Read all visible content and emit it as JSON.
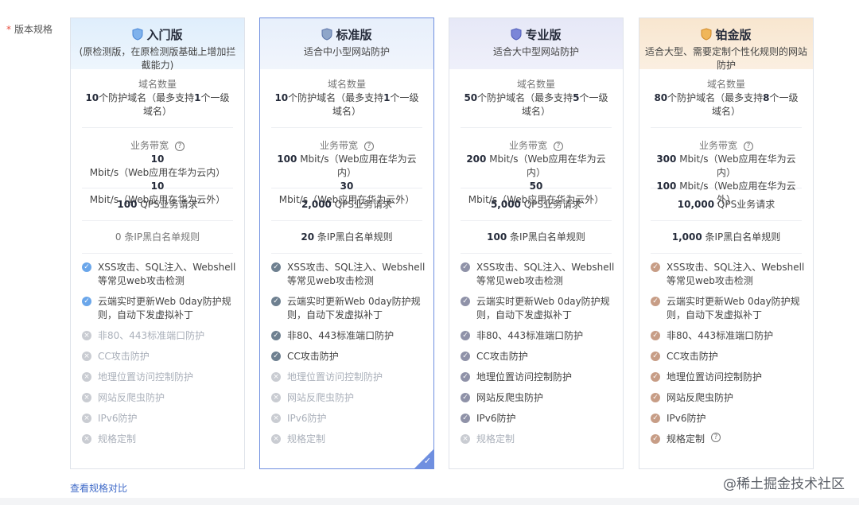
{
  "field_label": "版本规格",
  "icons": {
    "check": "✓",
    "cross": "×",
    "help": "?",
    "shield": "shield-icon"
  },
  "colors": {
    "selected_border": "#6f8fe0",
    "entry_check": "#6aa6ea",
    "std_check": "#6e8090",
    "pro_check": "#8f92a8",
    "plat_check": "#c79d86",
    "disabled": "#c9ccd2"
  },
  "plans": [
    {
      "name": "入门版",
      "subtitle": "(原检测版，在原检测版基础上增加拦截能力)",
      "domain_label": "域名数量",
      "domain_count": "10",
      "domain_mid": "个防护域名（最多支持",
      "domain_top": "1",
      "domain_tail": "个一级域名）",
      "bw_label": "业务带宽",
      "bw_in_val": "10",
      "bw_in_text": " Mbit/s（Web应用在华为云内）",
      "bw_out_val": "10",
      "bw_out_text": " Mbit/s（Web应用在华为云外）",
      "qps_val": "100",
      "qps_text": " QPS业务请求",
      "ip_val": "0",
      "ip_text": " 条IP黑白名单规则",
      "features": [
        {
          "text": "XSS攻击、SQL注入、Webshell等常见web攻击检测",
          "on": true
        },
        {
          "text": "云端实时更新Web 0day防护规则，自动下发虚拟补丁",
          "on": true
        },
        {
          "text": "非80、443标准端口防护",
          "on": false
        },
        {
          "text": "CC攻击防护",
          "on": false
        },
        {
          "text": "地理位置访问控制防护",
          "on": false
        },
        {
          "text": "网站反爬虫防护",
          "on": false
        },
        {
          "text": "IPv6防护",
          "on": false
        },
        {
          "text": "规格定制",
          "on": false
        }
      ]
    },
    {
      "name": "标准版",
      "subtitle": "适合中小型网站防护",
      "domain_label": "域名数量",
      "domain_count": "10",
      "domain_mid": "个防护域名（最多支持",
      "domain_top": "1",
      "domain_tail": "个一级域名）",
      "bw_label": "业务带宽",
      "bw_in_val": "100",
      "bw_in_text": " Mbit/s（Web应用在华为云内）",
      "bw_out_val": "30",
      "bw_out_text": " Mbit/s（Web应用在华为云外）",
      "qps_val": "2,000",
      "qps_text": " QPS业务请求",
      "ip_val": "20",
      "ip_text": " 条IP黑白名单规则",
      "features": [
        {
          "text": "XSS攻击、SQL注入、Webshell等常见web攻击检测",
          "on": true
        },
        {
          "text": "云端实时更新Web 0day防护规则，自动下发虚拟补丁",
          "on": true
        },
        {
          "text": "非80、443标准端口防护",
          "on": true
        },
        {
          "text": "CC攻击防护",
          "on": true
        },
        {
          "text": "地理位置访问控制防护",
          "on": false
        },
        {
          "text": "网站反爬虫防护",
          "on": false
        },
        {
          "text": "IPv6防护",
          "on": false
        },
        {
          "text": "规格定制",
          "on": false
        }
      ]
    },
    {
      "name": "专业版",
      "subtitle": "适合大中型网站防护",
      "domain_label": "域名数量",
      "domain_count": "50",
      "domain_mid": "个防护域名（最多支持",
      "domain_top": "5",
      "domain_tail": "个一级域名）",
      "bw_label": "业务带宽",
      "bw_in_val": "200",
      "bw_in_text": " Mbit/s（Web应用在华为云内）",
      "bw_out_val": "50",
      "bw_out_text": " Mbit/s（Web应用在华为云外）",
      "qps_val": "5,000",
      "qps_text": " QPS业务请求",
      "ip_val": "100",
      "ip_text": " 条IP黑白名单规则",
      "features": [
        {
          "text": "XSS攻击、SQL注入、Webshell等常见web攻击检测",
          "on": true
        },
        {
          "text": "云端实时更新Web 0day防护规则，自动下发虚拟补丁",
          "on": true
        },
        {
          "text": "非80、443标准端口防护",
          "on": true
        },
        {
          "text": "CC攻击防护",
          "on": true
        },
        {
          "text": "地理位置访问控制防护",
          "on": true
        },
        {
          "text": "网站反爬虫防护",
          "on": true
        },
        {
          "text": "IPv6防护",
          "on": true
        },
        {
          "text": "规格定制",
          "on": false
        }
      ]
    },
    {
      "name": "铂金版",
      "subtitle": "适合大型、需要定制个性化规则的网站防护",
      "domain_label": "域名数量",
      "domain_count": "80",
      "domain_mid": "个防护域名（最多支持",
      "domain_top": "8",
      "domain_tail": "个一级域名）",
      "bw_label": "业务带宽",
      "bw_in_val": "300",
      "bw_in_text": " Mbit/s（Web应用在华为云内）",
      "bw_out_val": "100",
      "bw_out_text": " Mbit/s（Web应用在华为云外）",
      "qps_val": "10,000",
      "qps_text": " QPS业务请求",
      "ip_val": "1,000",
      "ip_text": " 条IP黑白名单规则",
      "features": [
        {
          "text": "XSS攻击、SQL注入、Webshell等常见web攻击检测",
          "on": true
        },
        {
          "text": "云端实时更新Web 0day防护规则，自动下发虚拟补丁",
          "on": true
        },
        {
          "text": "非80、443标准端口防护",
          "on": true
        },
        {
          "text": "CC攻击防护",
          "on": true
        },
        {
          "text": "地理位置访问控制防护",
          "on": true
        },
        {
          "text": "网站反爬虫防护",
          "on": true
        },
        {
          "text": "IPv6防护",
          "on": true
        },
        {
          "text": "规格定制",
          "on": true
        }
      ]
    }
  ],
  "compare_link": "查看规格对比",
  "watermark": "@稀土掘金技术社区"
}
